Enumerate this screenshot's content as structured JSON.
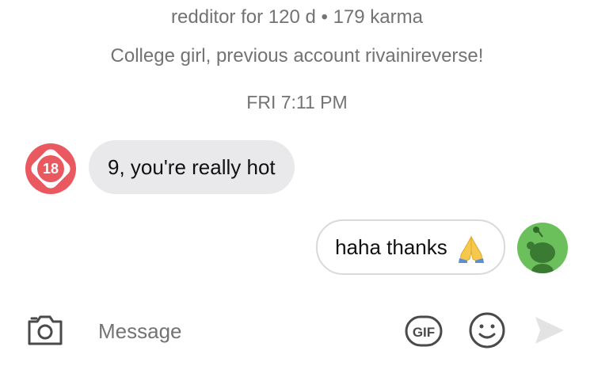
{
  "profile": {
    "stats": "redditor for 120 d • 179 karma",
    "bio": "College girl, previous account rivainireverse!"
  },
  "thread": {
    "timestamp": "FRI 7:11 PM",
    "messages": [
      {
        "sender": "other",
        "avatar_badge": "18",
        "text": "9, you're really hot"
      },
      {
        "sender": "me",
        "text": "haha thanks",
        "emoji": "folded-hands-emoji"
      }
    ]
  },
  "composer": {
    "placeholder": "Message",
    "gif_label": "GIF",
    "icons": [
      "camera-icon",
      "gif-icon",
      "emoji-icon",
      "send-icon"
    ]
  },
  "colors": {
    "incoming_bubble": "#e9e9eb",
    "outgoing_border": "#d9d9d9",
    "badge_red": "#e9595f",
    "my_avatar_green": "#6bc05b",
    "muted_text": "#737373"
  }
}
